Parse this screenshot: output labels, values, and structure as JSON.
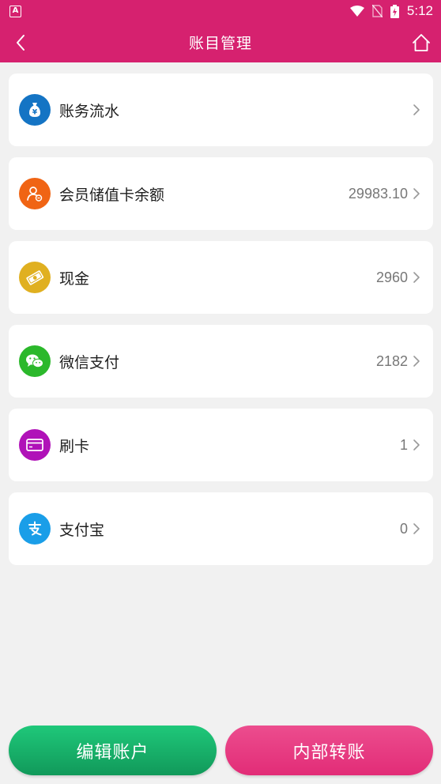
{
  "status_bar": {
    "time": "5:12",
    "app_badge": "A"
  },
  "header": {
    "title": "账目管理",
    "back_icon": "chevron-left-icon",
    "home_icon": "home-icon"
  },
  "accounts": [
    {
      "label": "账务流水",
      "amount": "",
      "icon": "money-bag-icon",
      "color": "#1474c4"
    },
    {
      "label": "会员储值卡余额",
      "amount": "29983.10",
      "icon": "member-icon",
      "color": "#f06414"
    },
    {
      "label": "现金",
      "amount": "2960",
      "icon": "cash-icon",
      "color": "#e0b020"
    },
    {
      "label": "微信支付",
      "amount": "2182",
      "icon": "wechat-icon",
      "color": "#2bb82b"
    },
    {
      "label": "刷卡",
      "amount": "1",
      "icon": "card-icon",
      "color": "#b012b8"
    },
    {
      "label": "支付宝",
      "amount": "0",
      "icon": "alipay-icon",
      "color": "#1a9ee8"
    }
  ],
  "buttons": {
    "edit_account": "编辑账户",
    "internal_transfer": "内部转账"
  },
  "colors": {
    "brand": "#d6216f",
    "edit_button": "#16b06a",
    "transfer_button": "#e53a7f"
  }
}
